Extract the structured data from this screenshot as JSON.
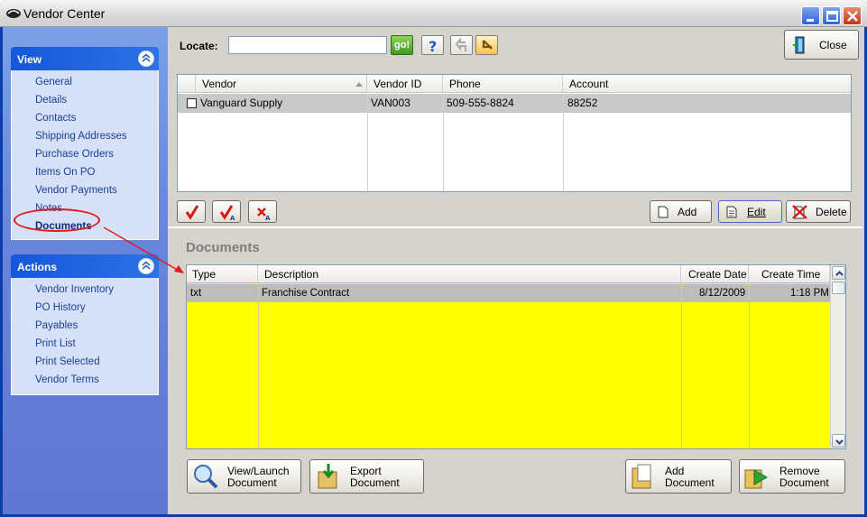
{
  "window": {
    "title": "Vendor Center"
  },
  "view_group": {
    "title": "View",
    "items": [
      "General",
      "Details",
      "Contacts",
      "Shipping Addresses",
      "Purchase Orders",
      "Items On PO",
      "Vendor Payments",
      "Notes",
      "Documents"
    ],
    "selected": "Documents"
  },
  "actions_group": {
    "title": "Actions",
    "items": [
      "Vendor Inventory",
      "PO History",
      "Payables",
      "Print List",
      "Print Selected",
      "Vendor Terms"
    ]
  },
  "toolbar": {
    "locate_label": "Locate:",
    "locate_value": "",
    "go_label": "go!",
    "help_icon": "question-icon",
    "back_icon": "back-arrow-icon",
    "refresh_icon": "undo-arrow-icon",
    "close_label": "Close"
  },
  "vendor_table": {
    "columns": [
      "Vendor",
      "Vendor ID",
      "Phone",
      "Account"
    ],
    "rows": [
      {
        "vendor": "Vanguard Supply",
        "vendor_id": "VAN003",
        "phone": "509-555-8824",
        "account": "88252"
      }
    ]
  },
  "vendor_buttons": {
    "check_icons": [
      "check-icon",
      "check-all-icon",
      "uncheck-all-icon"
    ],
    "add_label": "Add",
    "edit_label": "Edit",
    "delete_label": "Delete"
  },
  "documents": {
    "title": "Documents",
    "columns": [
      "Type",
      "Description",
      "Create Date",
      "Create Time"
    ],
    "rows": [
      {
        "type": "txt",
        "description": "Franchise Contract",
        "create_date": "8/12/2009",
        "create_time": "1:18 PM"
      }
    ],
    "grid_color": "#FFFF00",
    "buttons": {
      "view_launch": [
        "View/Launch",
        "Document"
      ],
      "export": [
        "Export",
        "Document"
      ],
      "add": [
        "Add",
        "Document"
      ],
      "remove": [
        "Remove",
        "Document"
      ]
    }
  },
  "annotation": {
    "color": "#E11A1A"
  }
}
